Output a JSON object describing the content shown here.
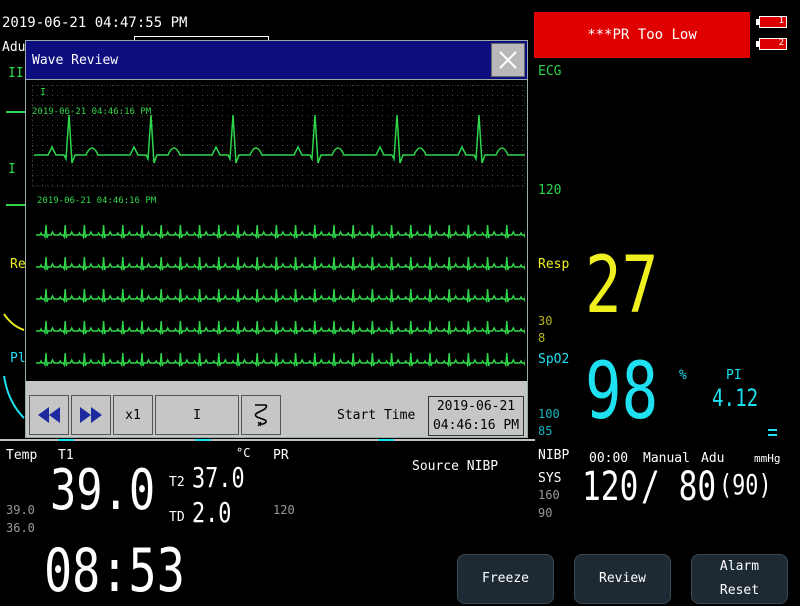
{
  "header": {
    "datetime": "2019-06-21 04:47:55 PM",
    "patient_type_partial": "Adu",
    "alarm_text": "***PR Too Low",
    "battery_1": "1",
    "battery_2": "2"
  },
  "left_wave_labels": {
    "lead_ii": "II",
    "lead_i": "I",
    "resp_partial": "Re",
    "pleth_partial": "Pl"
  },
  "wave_review": {
    "title": "Wave Review",
    "trace_label": "I",
    "top_timestamp": "2019-06-21 04:46:16 PM",
    "bottom_timestamp": "2019-06-21 04:46:16 PM",
    "speed": "x1",
    "lead_select": "I",
    "start_time_label": "Start Time",
    "start_date": "2019-06-21",
    "start_time": "04:46:16 PM"
  },
  "params": {
    "ecg": {
      "label": "ECG",
      "upper": "120"
    },
    "resp": {
      "label": "Resp",
      "value": "27",
      "upper": "30",
      "lower": "8"
    },
    "spo2": {
      "label": "SpO2",
      "value": "98",
      "unit": "%",
      "pi_label": "PI",
      "pi_value": "4.12",
      "upper": "100",
      "lower": "85"
    },
    "temp": {
      "label": "Temp",
      "t1_label": "T1",
      "t1_value": "39.0",
      "unit": "°C",
      "t2_label": "T2",
      "t2_value": "37.0",
      "td_label": "TD",
      "td_value": "2.0",
      "upper": "39.0",
      "lower": "36.0"
    },
    "pr": {
      "label": "PR",
      "source": "Source NIBP",
      "upper": "120"
    },
    "nibp": {
      "label": "NIBP",
      "time": "00:00",
      "mode": "Manual",
      "patient": "Adu",
      "unit": "mmHg",
      "sys_label": "SYS",
      "sys": "120",
      "dia": "/ 80",
      "map": "(90)",
      "upper": "160",
      "lower": "90"
    }
  },
  "clock": "08:53",
  "buttons": {
    "freeze": "Freeze",
    "review": "Review",
    "alarm_reset_1": "Alarm",
    "alarm_reset_2": "Reset"
  },
  "colors": {
    "ecg": "#2fd64a",
    "resp": "#f0f020",
    "spo2": "#1ee0f0",
    "alarm": "#e00000",
    "dialog_title": "#0d0d80"
  }
}
